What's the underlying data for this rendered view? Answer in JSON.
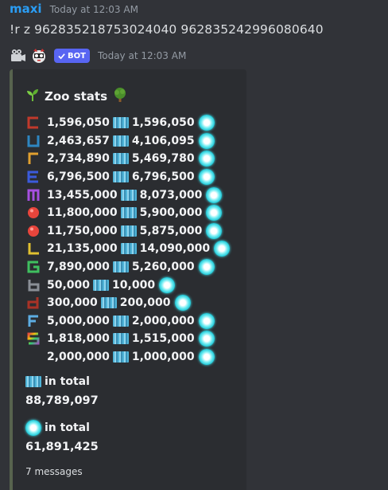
{
  "message": {
    "username": "maxi",
    "timestamp": "Today at 12:03 AM",
    "command": "!r z 962835218753024040 962835242996080640"
  },
  "bot": {
    "badge": "BOT",
    "timestamp": "Today at 12:03 AM"
  },
  "embed": {
    "title": "Zoo stats",
    "accent_color": "#57634e",
    "rows": [
      {
        "icon": "c-letter-icon",
        "left": "1,596,050",
        "right": "1,596,050"
      },
      {
        "icon": "u-letter-icon",
        "left": "2,463,657",
        "right": "4,106,095"
      },
      {
        "icon": "r-letter-icon",
        "left": "2,734,890",
        "right": "5,469,780"
      },
      {
        "icon": "e-letter-icon",
        "left": "6,796,500",
        "right": "6,796,500"
      },
      {
        "icon": "m-letter-icon",
        "left": "13,455,000",
        "right": "8,073,000"
      },
      {
        "icon": "red-ball-icon",
        "left": "11,800,000",
        "right": "5,900,000"
      },
      {
        "icon": "red-ball-icon",
        "left": "11,750,000",
        "right": "5,875,000"
      },
      {
        "icon": "l-letter-icon",
        "left": "21,135,000",
        "right": "14,090,000"
      },
      {
        "icon": "g-letter-icon",
        "left": "7,890,000",
        "right": "5,260,000"
      },
      {
        "icon": "b-letter-icon",
        "left": "50,000",
        "right": "10,000"
      },
      {
        "icon": "d-letter-icon",
        "left": "300,000",
        "right": "200,000"
      },
      {
        "icon": "f-letter-icon",
        "left": "5,000,000",
        "right": "2,000,000"
      },
      {
        "icon": "rainbow-s-icon",
        "left": "1,818,000",
        "right": "1,515,000"
      },
      {
        "icon": "blank-icon",
        "left": "2,000,000",
        "right": "1,000,000"
      }
    ],
    "total1_label": "in total",
    "total1_value": "88,789,097",
    "total2_label": "in total",
    "total2_value": "61,891,425",
    "footer": "7 messages"
  }
}
